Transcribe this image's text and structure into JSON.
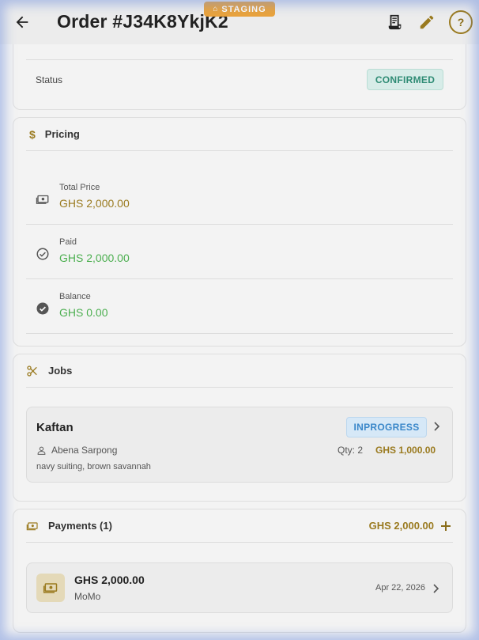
{
  "header": {
    "title": "Order #J34K8YkjK2",
    "staging_label": "STAGING",
    "help_label": "?"
  },
  "details": {
    "status_label": "Status",
    "status_value": "CONFIRMED"
  },
  "pricing": {
    "title": "Pricing",
    "total_label": "Total Price",
    "total_value": "GHS 2,000.00",
    "paid_label": "Paid",
    "paid_value": "GHS 2,000.00",
    "balance_label": "Balance",
    "balance_value": "GHS 0.00"
  },
  "jobs": {
    "title": "Jobs",
    "items": [
      {
        "name": "Kaftan",
        "status": "INPROGRESS",
        "assignee": "Abena Sarpong",
        "qty": "Qty: 2",
        "price": "GHS 1,000.00",
        "materials": "navy suiting, brown savannah"
      }
    ]
  },
  "payments": {
    "title": "Payments (1)",
    "total": "GHS 2,000.00",
    "items": [
      {
        "amount": "GHS 2,000.00",
        "method": "MoMo",
        "date": "Apr 22, 2026"
      }
    ]
  },
  "colors": {
    "accent": "#9a7a1f",
    "green": "#4caf50",
    "confirmed_bg": "#d7ece8",
    "confirmed_text": "#2e8b74",
    "inprogress_bg": "#d6e8f7",
    "inprogress_text": "#3a87c9"
  }
}
